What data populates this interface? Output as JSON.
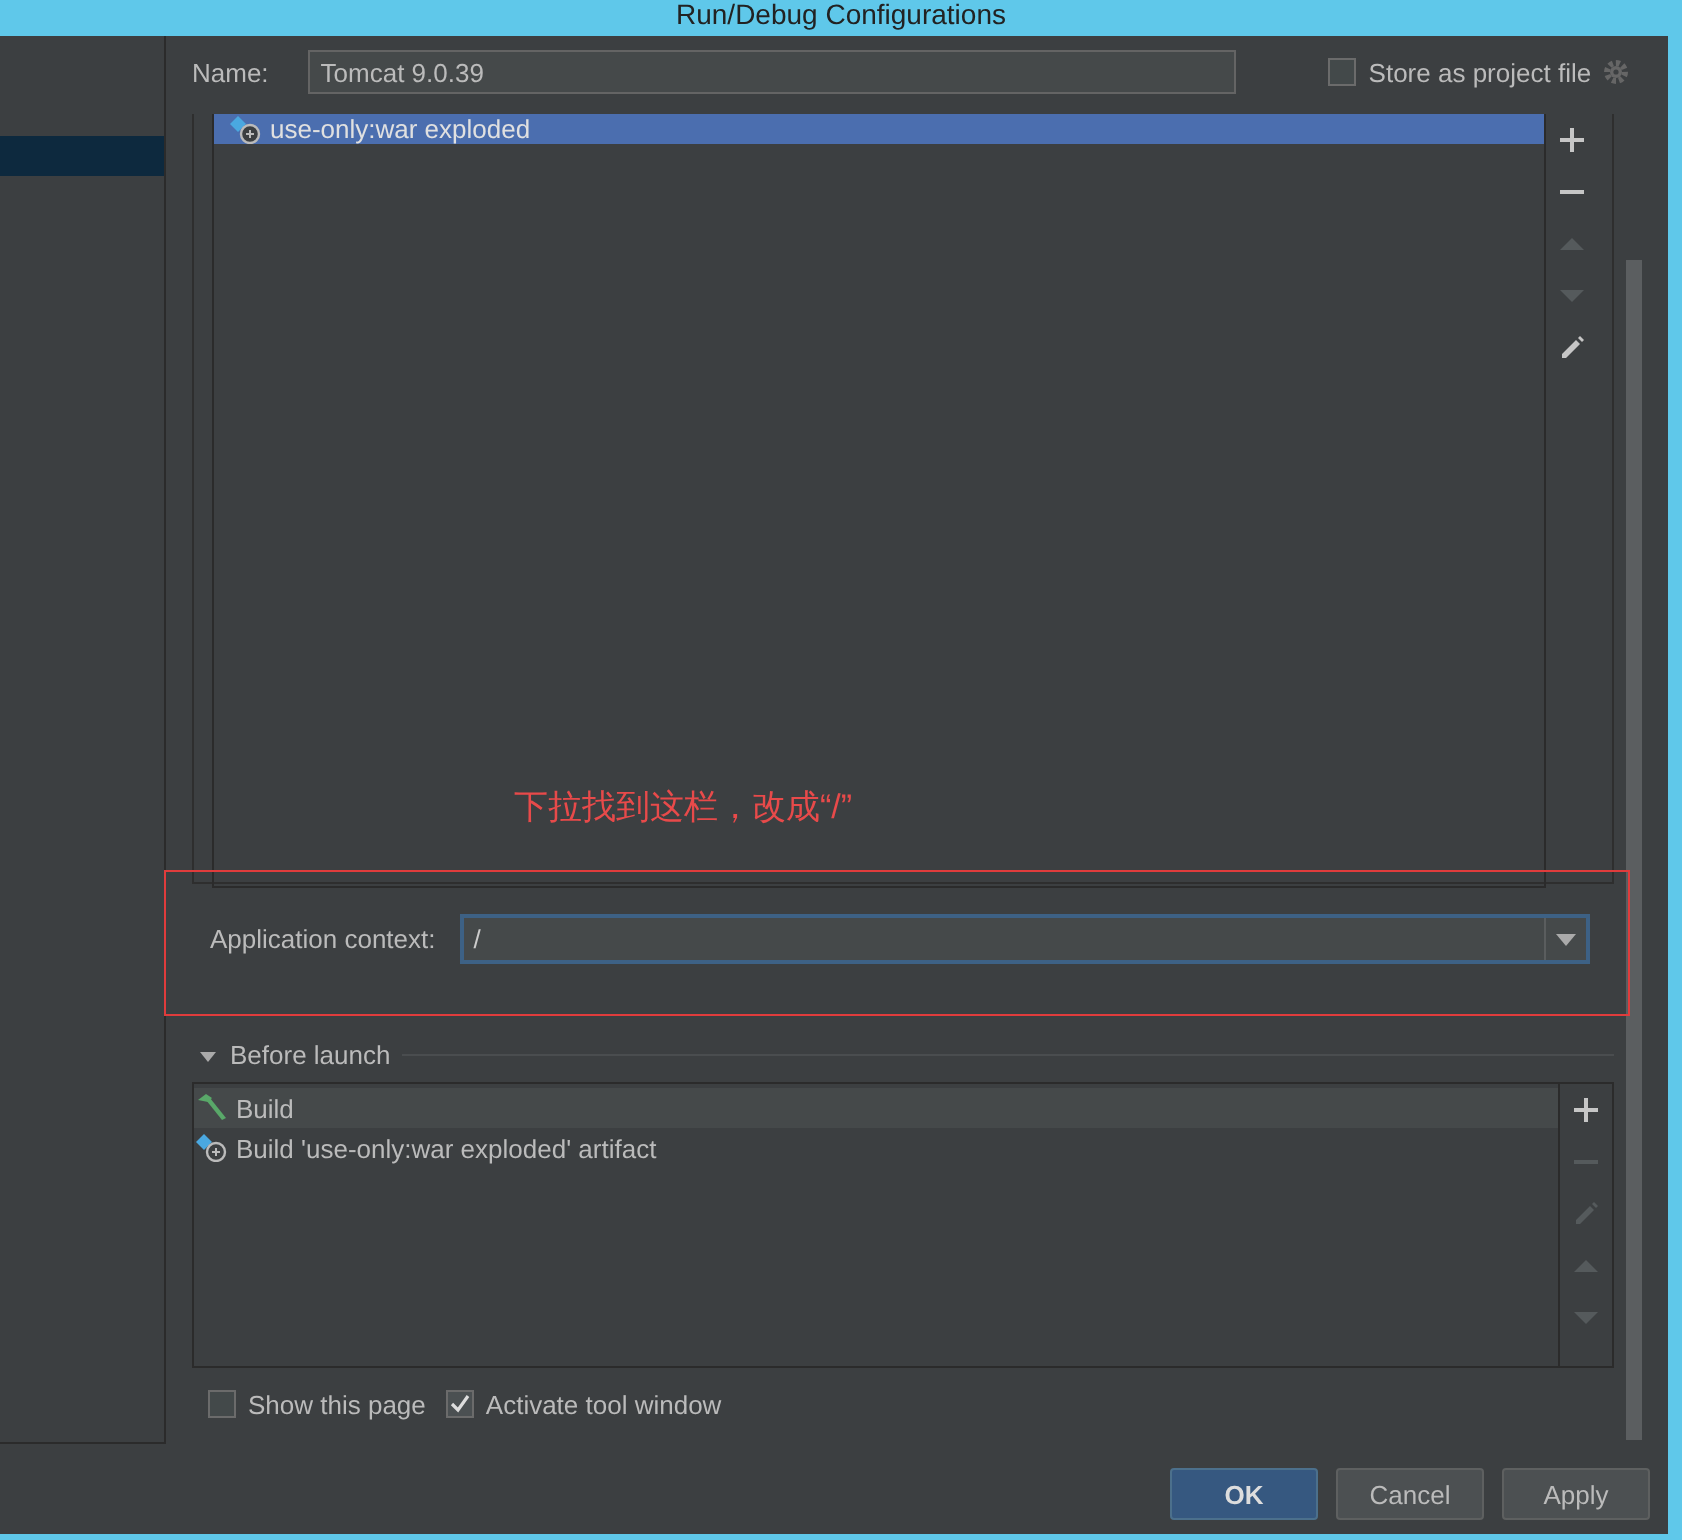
{
  "window": {
    "title": "Run/Debug Configurations"
  },
  "sidebar": {
    "items": [
      {
        "selected": true
      }
    ]
  },
  "name_field": {
    "label": "Name:",
    "value": "Tomcat 9.0.39"
  },
  "store_as_project_file": {
    "label": "Store as project file",
    "checked": false
  },
  "artifacts": {
    "items": [
      {
        "label": "use-only:war exploded",
        "selected": true
      }
    ],
    "toolbar": [
      {
        "kind": "add",
        "disabled": false
      },
      {
        "kind": "remove",
        "disabled": false
      },
      {
        "kind": "up",
        "disabled": true
      },
      {
        "kind": "down",
        "disabled": true
      },
      {
        "kind": "edit",
        "disabled": false
      }
    ]
  },
  "annotation": {
    "text": "下拉找到这栏，改成“/”"
  },
  "application_context": {
    "label": "Application context:",
    "value": "/"
  },
  "before_launch": {
    "title": "Before launch",
    "expanded": true,
    "tasks": [
      {
        "kind": "build",
        "label": "Build",
        "selected": true
      },
      {
        "kind": "artifact",
        "label": "Build 'use-only:war exploded' artifact",
        "selected": false
      }
    ],
    "toolbar": [
      {
        "kind": "add",
        "disabled": false
      },
      {
        "kind": "remove",
        "disabled": true
      },
      {
        "kind": "edit",
        "disabled": true
      },
      {
        "kind": "up",
        "disabled": true
      },
      {
        "kind": "down",
        "disabled": true
      }
    ]
  },
  "options": [
    {
      "label": "Show this page",
      "checked": false
    },
    {
      "label": "Activate tool window",
      "checked": true
    }
  ],
  "buttons": [
    {
      "label": "OK",
      "default": true
    },
    {
      "label": "Cancel",
      "default": false
    },
    {
      "label": "Apply",
      "default": false
    }
  ]
}
